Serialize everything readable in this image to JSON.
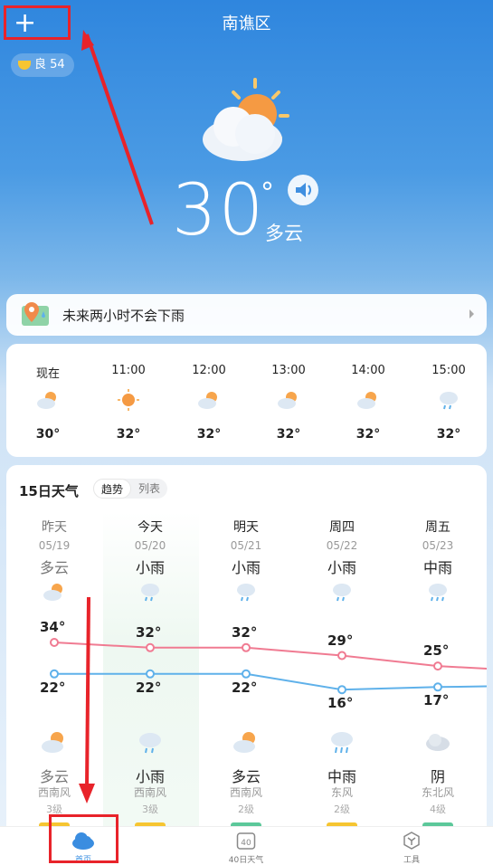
{
  "header": {
    "city": "南谯区",
    "add_icon": "plus-icon",
    "add_label": "+"
  },
  "aqi": {
    "label": "良 54",
    "icon": "leaf-icon"
  },
  "current": {
    "temp": "30",
    "deg": "°",
    "condition": "多云",
    "icon": "partly-cloudy-icon",
    "speaker_icon": "speaker-icon"
  },
  "rain_notice": {
    "text": "未来两小时不会下雨",
    "icon": "map-pin-icon"
  },
  "hourly": [
    {
      "time": "现在",
      "temp": "30°",
      "icon": "partly-cloudy-icon"
    },
    {
      "time": "11:00",
      "temp": "32°",
      "icon": "sunny-icon"
    },
    {
      "time": "12:00",
      "temp": "32°",
      "icon": "partly-cloudy-icon"
    },
    {
      "time": "13:00",
      "temp": "32°",
      "icon": "partly-cloudy-icon"
    },
    {
      "time": "14:00",
      "temp": "32°",
      "icon": "partly-cloudy-icon"
    },
    {
      "time": "15:00",
      "temp": "32°",
      "icon": "light-rain-icon"
    }
  ],
  "forecast": {
    "title": "15日天气",
    "tab_trend": "趋势",
    "tab_list": "列表",
    "days": [
      {
        "name": "昨天",
        "date": "05/19",
        "day_weather": "多云",
        "night_weather": "多云",
        "high": "34°",
        "low": "22°",
        "wind": "西南风",
        "level": "3级",
        "aq_color": "#f6c531",
        "past": true
      },
      {
        "name": "今天",
        "date": "05/20",
        "day_weather": "小雨",
        "night_weather": "小雨",
        "high": "32°",
        "low": "22°",
        "wind": "西南风",
        "level": "3级",
        "aq_color": "#f6c531",
        "past": false
      },
      {
        "name": "明天",
        "date": "05/21",
        "day_weather": "小雨",
        "night_weather": "多云",
        "high": "32°",
        "low": "22°",
        "wind": "西南风",
        "level": "2级",
        "aq_color": "#5cc89a",
        "past": false
      },
      {
        "name": "周四",
        "date": "05/22",
        "day_weather": "小雨",
        "night_weather": "中雨",
        "high": "29°",
        "low": "16°",
        "wind": "东风",
        "level": "2级",
        "aq_color": "#f6c531",
        "past": false
      },
      {
        "name": "周五",
        "date": "05/23",
        "day_weather": "中雨",
        "night_weather": "阴",
        "high": "25°",
        "low": "17°",
        "wind": "东北风",
        "level": "4级",
        "aq_color": "#5cc89a",
        "past": false
      }
    ]
  },
  "chart_data": {
    "type": "line",
    "categories": [
      "05/19",
      "05/20",
      "05/21",
      "05/22",
      "05/23"
    ],
    "series": [
      {
        "values": [
          34,
          32,
          32,
          29,
          25
        ],
        "color": "#f07b92"
      },
      {
        "values": [
          22,
          22,
          22,
          16,
          17
        ],
        "color": "#5fb1ea"
      }
    ]
  },
  "tabbar": [
    {
      "label": "首页",
      "icon": "cloud-icon"
    },
    {
      "label": "40日天气",
      "icon": "calendar-40-icon",
      "badge": "40"
    },
    {
      "label": "工具",
      "icon": "tools-icon"
    }
  ]
}
